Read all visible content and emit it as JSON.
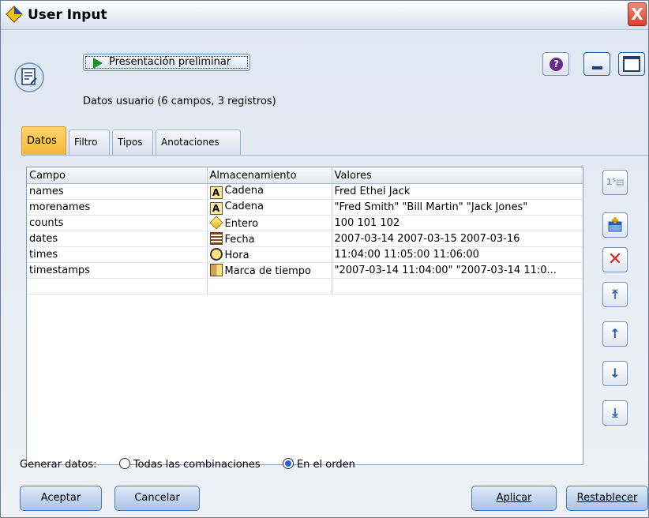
{
  "window": {
    "title": "User Input",
    "close_glyph": "X"
  },
  "toolbar": {
    "preview_label": "Presentación preliminar",
    "help_glyph": "?"
  },
  "summary": "Datos usuario (6 campos, 3 registros)",
  "tabs": [
    {
      "label": "Datos",
      "active": true
    },
    {
      "label": "Filtro",
      "active": false
    },
    {
      "label": "Tipos",
      "active": false
    },
    {
      "label": "Anotaciones",
      "active": false
    }
  ],
  "table": {
    "columns": [
      "Campo",
      "Almacenamiento",
      "Valores"
    ],
    "rows": [
      {
        "field": "names",
        "storage_icon": "string-icon",
        "storage": "Cadena",
        "values": "Fred Ethel Jack"
      },
      {
        "field": "morenames",
        "storage_icon": "string-icon",
        "storage": "Cadena",
        "values": "\"Fred Smith\" \"Bill Martin\" \"Jack Jones\""
      },
      {
        "field": "counts",
        "storage_icon": "integer-icon",
        "storage": "Entero",
        "values": "100 101 102"
      },
      {
        "field": "dates",
        "storage_icon": "date-icon",
        "storage": "Fecha",
        "values": "2007-03-14 2007-03-15 2007-03-16"
      },
      {
        "field": "times",
        "storage_icon": "time-icon",
        "storage": "Hora",
        "values": "11:04:00 11:05:00 11:06:00"
      },
      {
        "field": "timestamps",
        "storage_icon": "timestamp-icon",
        "storage": "Marca de tiempo",
        "values": "\"2007-03-14 11:04:00\" \"2007-03-14 11:0..."
      }
    ]
  },
  "side_buttons": [
    {
      "name": "specify-values-icon",
      "glyph": "1⁵▤"
    },
    {
      "name": "add-field-icon",
      "glyph": "+"
    },
    {
      "name": "delete-icon",
      "glyph": "✕"
    },
    {
      "name": "move-top-icon",
      "glyph": "⤒"
    },
    {
      "name": "move-up-icon",
      "glyph": "↑"
    },
    {
      "name": "move-down-icon",
      "glyph": "↓"
    },
    {
      "name": "move-bottom-icon",
      "glyph": "⤓"
    }
  ],
  "generate": {
    "label": "Generar datos:",
    "options": [
      {
        "label": "Todas las combinaciones",
        "checked": false
      },
      {
        "label": "En el orden",
        "checked": true
      }
    ]
  },
  "buttons": {
    "ok": "Aceptar",
    "cancel": "Cancelar",
    "apply": "Aplicar",
    "reset": "Restablecer"
  },
  "colors": {
    "accent_tab": "#f7b73a",
    "delete_red": "#d8281c",
    "arrow_blue": "#1f5fb8"
  }
}
